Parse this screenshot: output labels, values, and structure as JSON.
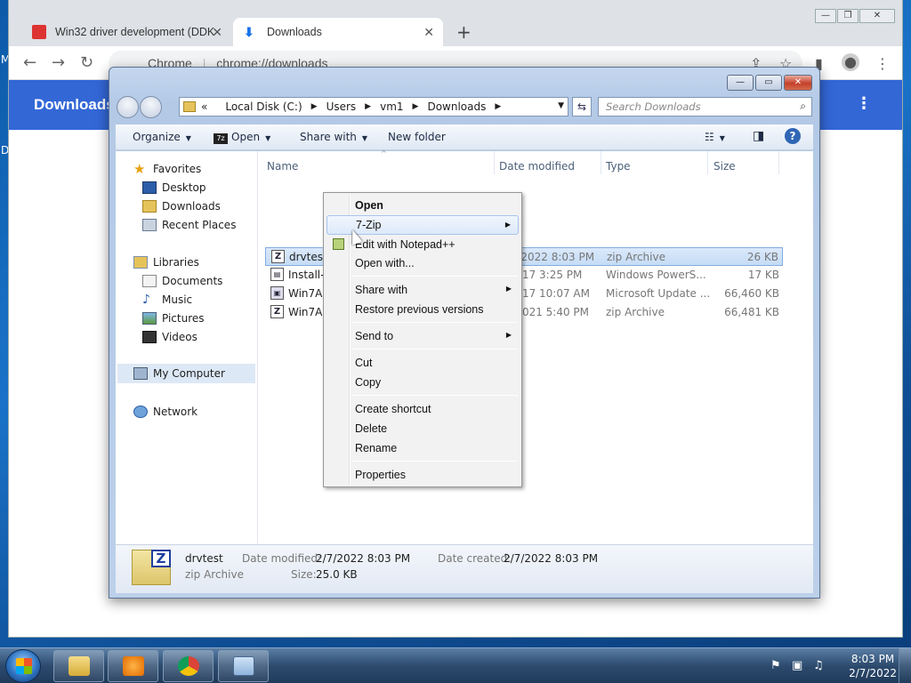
{
  "desktop": {
    "left_marks": [
      "M",
      "D"
    ]
  },
  "chrome": {
    "tabs": [
      {
        "title": "Win32 driver development (DDK"
      },
      {
        "title": "Downloads"
      }
    ],
    "omnibox": {
      "site": "Chrome",
      "url": "chrome://downloads"
    },
    "page_title": "Downloads"
  },
  "explorer": {
    "address": {
      "crumbs": [
        "Local Disk (C:)",
        "Users",
        "vm1",
        "Downloads"
      ],
      "prefix": "«"
    },
    "search_placeholder": "Search Downloads",
    "commands": {
      "organize": "Organize",
      "open": "Open",
      "share_with": "Share with",
      "new_folder": "New folder"
    },
    "nav": {
      "favorites": "Favorites",
      "fav_items": [
        "Desktop",
        "Downloads",
        "Recent Places"
      ],
      "libraries": "Libraries",
      "lib_items": [
        "Documents",
        "Music",
        "Pictures",
        "Videos"
      ],
      "computer": "My Computer",
      "network": "Network"
    },
    "columns": {
      "name": "Name",
      "date": "Date modified",
      "type": "Type",
      "size": "Size"
    },
    "files": [
      {
        "name": "drvtest",
        "date": "2/7/2022 8:03 PM",
        "type": "zip Archive",
        "size": "26 KB",
        "icon": "zip-icon"
      },
      {
        "name": "Install-",
        "date": "3/2017 3:25 PM",
        "type": "Windows PowerS...",
        "size": "17 KB",
        "icon": "script-icon"
      },
      {
        "name": "Win7A",
        "date": "3/2017 10:07 AM",
        "type": "Microsoft Update ...",
        "size": "66,460 KB",
        "icon": "update-icon"
      },
      {
        "name": "Win7A",
        "date": "30/2021 5:40 PM",
        "type": "zip Archive",
        "size": "66,481 KB",
        "icon": "zip-icon"
      }
    ],
    "details": {
      "name": "drvtest",
      "type": "zip Archive",
      "modified_label": "Date modified:",
      "modified_value": "2/7/2022 8:03 PM",
      "created_label": "Date created:",
      "created_value": "2/7/2022 8:03 PM",
      "size_label": "Size:",
      "size_value": "25.0 KB"
    }
  },
  "context_menu": {
    "open": "Open",
    "sevenzip": "7-Zip",
    "edit_notepad": "Edit with Notepad++",
    "open_with": "Open with...",
    "share_with": "Share with",
    "restore": "Restore previous versions",
    "send_to": "Send to",
    "cut": "Cut",
    "copy": "Copy",
    "create_shortcut": "Create shortcut",
    "delete": "Delete",
    "rename": "Rename",
    "properties": "Properties"
  },
  "taskbar": {
    "time": "8:03 PM",
    "date": "2/7/2022"
  }
}
